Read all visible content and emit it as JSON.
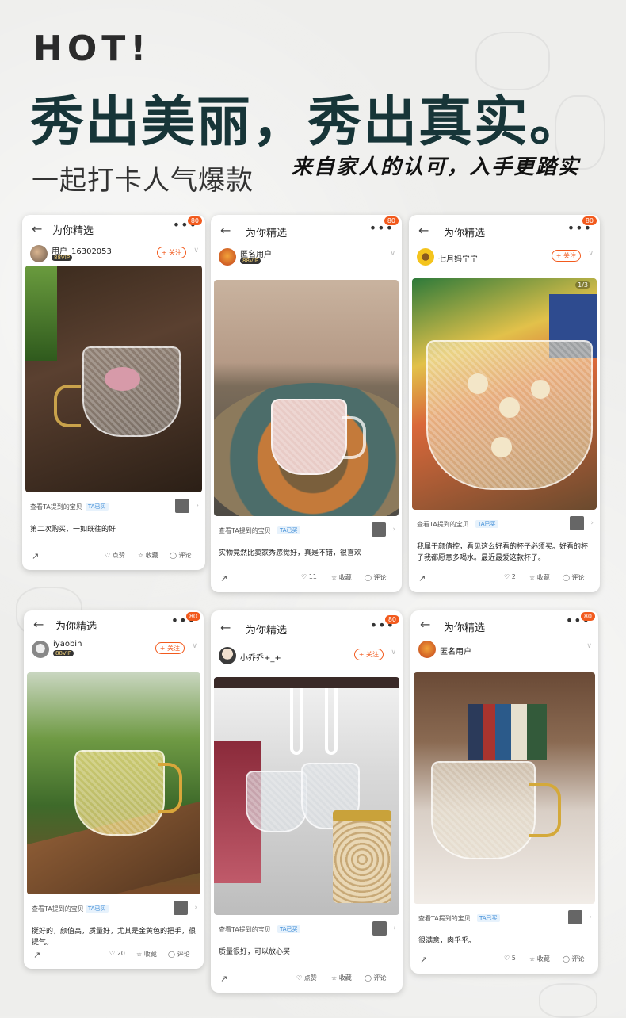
{
  "hero": {
    "hot": "HOT!",
    "title": "秀出美丽，秀出真实。",
    "subtitle": "一起打卡人气爆款",
    "signature": "来自家人的认可，入手更踏实"
  },
  "cards": [
    {
      "header_title": "为你精选",
      "badge": "80",
      "user_name": "用户_16302053",
      "vip": "88VIP",
      "follow": "+ 关注",
      "mention": "查看TA提到的宝贝",
      "mention_tag": "TA已买",
      "comment": "第二次购买，一如既往的好",
      "like": "点赞",
      "collect": "收藏",
      "comment_label": "评论"
    },
    {
      "header_title": "为你精选",
      "badge": "80",
      "user_name": "匿名用户",
      "vip": "88VIP",
      "follow": "+ 关注",
      "mention": "查看TA提到的宝贝",
      "mention_tag": "TA已买",
      "comment": "实物竟然比卖家秀感觉好，真是不错，很喜欢",
      "like": "11",
      "collect": "收藏",
      "comment_label": "评论"
    },
    {
      "header_title": "为你精选",
      "badge": "80",
      "user_name": "七月妈宁宁",
      "vip": "",
      "follow": "+ 关注",
      "page": "1/3",
      "mention": "查看TA提到的宝贝",
      "mention_tag": "TA已买",
      "comment": "我属于颜值控，看见这么好看的杯子必须买。好看的杯子我都愿意多喝水。最近最爱这款杯子。",
      "like": "2",
      "collect": "收藏",
      "comment_label": "评论"
    },
    {
      "header_title": "为你精选",
      "badge": "80",
      "user_name": "iyaobin",
      "vip": "88VIP",
      "follow": "+ 关注",
      "mention": "查看TA提到的宝贝",
      "mention_tag": "TA已买",
      "comment": "挺好的，颜值高，质量好，尤其是金黄色的把手，很提气。",
      "like": "20",
      "collect": "收藏",
      "comment_label": "评论"
    },
    {
      "header_title": "为你精选",
      "badge": "80",
      "user_name": "小乔乔+_+",
      "vip": "",
      "follow": "+ 关注",
      "mention": "查看TA提到的宝贝",
      "mention_tag": "TA已买",
      "comment": "质量很好，可以放心买",
      "like": "点赞",
      "collect": "收藏",
      "comment_label": "评论"
    },
    {
      "header_title": "为你精选",
      "badge": "80",
      "user_name": "匿名用户",
      "vip": "",
      "follow": "",
      "mention": "查看TA提到的宝贝",
      "mention_tag": "TA已买",
      "comment": "很满意，肉乎乎。",
      "like": "5",
      "collect": "收藏",
      "comment_label": "评论"
    }
  ]
}
